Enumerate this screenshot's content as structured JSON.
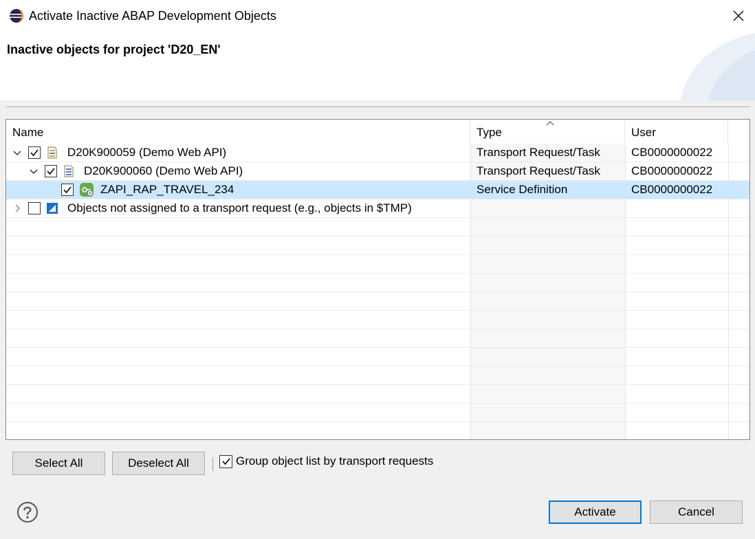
{
  "window": {
    "title": "Activate Inactive ABAP Development Objects",
    "icons": {
      "app": "eclipse-icon",
      "close": "close-icon"
    }
  },
  "header": {
    "title": "Inactive objects for project 'D20_EN'"
  },
  "table": {
    "columns": {
      "name": "Name",
      "type": "Type",
      "user": "User"
    },
    "sorted_by": "Type",
    "rows": [
      {
        "level": 0,
        "expanded": true,
        "checked": true,
        "icon": "transport-request-icon",
        "name": "D20K900059 (Demo Web API)",
        "type": "Transport Request/Task",
        "user": "CB0000000022"
      },
      {
        "level": 1,
        "expanded": true,
        "checked": true,
        "icon": "transport-task-icon",
        "name": "D20K900060 (Demo Web API)",
        "type": "Transport Request/Task",
        "user": "CB0000000022"
      },
      {
        "level": 2,
        "expanded": null,
        "checked": true,
        "selected": true,
        "icon": "service-definition-icon",
        "name": "ZAPI_RAP_TRAVEL_234",
        "type": "Service Definition",
        "user": "CB0000000022"
      },
      {
        "level": 0,
        "expanded": false,
        "checked": false,
        "icon": "local-objects-icon",
        "name": "Objects not assigned to a transport request (e.g., objects in $TMP)",
        "type": "",
        "user": ""
      }
    ]
  },
  "actions": {
    "select_all": "Select All",
    "deselect_all": "Deselect All",
    "group_by_label": "Group object list by transport requests",
    "group_by_checked": true
  },
  "footer": {
    "help_icon": "help-icon",
    "activate": "Activate",
    "cancel": "Cancel"
  },
  "colors": {
    "selection": "#cce8ff",
    "accent": "#0078d7",
    "dialog_bg": "#f0f0f0"
  }
}
